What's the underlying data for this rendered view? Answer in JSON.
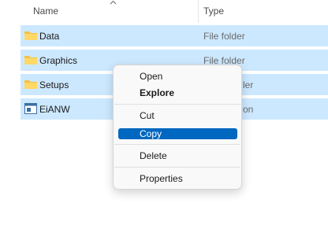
{
  "header": {
    "name_label": "Name",
    "type_label": "Type"
  },
  "rows": [
    {
      "name": "Data",
      "type": "File folder",
      "icon": "folder-icon"
    },
    {
      "name": "Graphics",
      "type": "File folder",
      "icon": "folder-icon"
    },
    {
      "name": "Setups",
      "type": "ler",
      "icon": "folder-icon"
    },
    {
      "name": "EiANW",
      "type": "on",
      "icon": "application-icon"
    }
  ],
  "context_menu": {
    "open": "Open",
    "explore": "Explore",
    "cut": "Cut",
    "copy": "Copy",
    "delete": "Delete",
    "properties": "Properties"
  },
  "colors": {
    "selection": "#cce8ff",
    "menu_highlight": "#0067c0",
    "folder": "#f5c242"
  }
}
